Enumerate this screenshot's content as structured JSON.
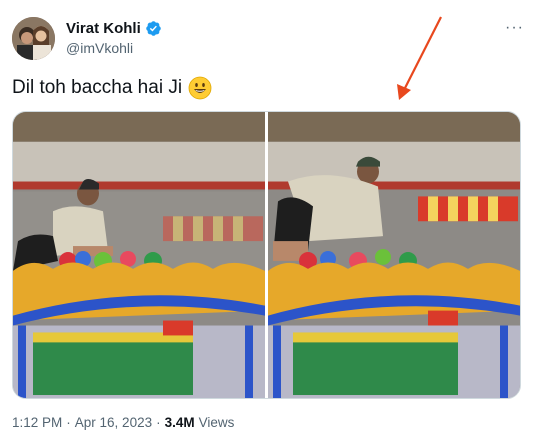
{
  "author": {
    "name": "Virat Kohli",
    "handle": "@imVkohli",
    "verified": true
  },
  "menu_icon": "more-horizontal-icon",
  "tweet": {
    "text": "Dil toh baccha hai Ji",
    "emoji": "grinning-face-emoji"
  },
  "media": {
    "count": 2
  },
  "meta": {
    "time": "1:12 PM",
    "separator": "·",
    "date": "Apr 16, 2023",
    "views_count": "3.4M",
    "views_label": "Views"
  },
  "colors": {
    "text_primary": "#0f1419",
    "text_secondary": "#536471",
    "verified_blue": "#1d9bf0",
    "annotation_arrow": "#e8481e"
  }
}
